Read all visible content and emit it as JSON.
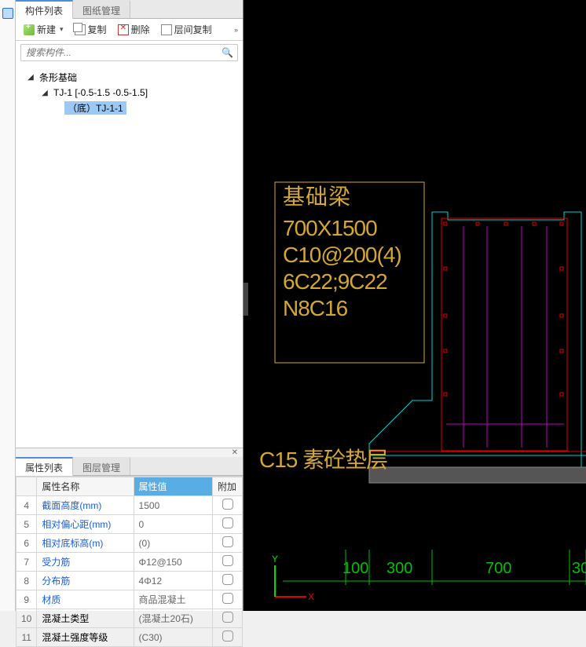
{
  "top_tabs": {
    "list": "构件列表",
    "drawing_mgr": "图纸管理"
  },
  "toolbar": {
    "new": "新建",
    "copy": "复制",
    "delete": "删除",
    "layer_copy": "层间复制"
  },
  "search": {
    "placeholder": "搜索构件..."
  },
  "tree": {
    "root": "条形基础",
    "node1": "TJ-1 [-0.5-1.5 -0.5-1.5]",
    "leaf1": "（底）TJ-1-1"
  },
  "lower_tabs": {
    "prop": "属性列表",
    "layer_mgr": "图层管理"
  },
  "prop_headers": {
    "name": "属性名称",
    "value": "属性值",
    "extra": "附加"
  },
  "props": [
    {
      "idx": 4,
      "name": "截面高度(mm)",
      "value": "1500",
      "link": true
    },
    {
      "idx": 5,
      "name": "相对偏心距(mm)",
      "value": "0",
      "link": true
    },
    {
      "idx": 6,
      "name": "相对底标高(m)",
      "value": "(0)",
      "link": true
    },
    {
      "idx": 7,
      "name": "受力筋",
      "value": "Φ12@150",
      "link": true
    },
    {
      "idx": 8,
      "name": "分布筋",
      "value": "4Φ12",
      "link": true
    },
    {
      "idx": 9,
      "name": "材质",
      "value": "商品混凝土",
      "link": true
    },
    {
      "idx": 10,
      "name": "混凝土类型",
      "value": "(混凝土20石)",
      "link": false
    },
    {
      "idx": 11,
      "name": "混凝土强度等级",
      "value": "(C30)",
      "link": false
    }
  ],
  "cad": {
    "labels": [
      "基础梁",
      "700X1500",
      "C10@200(4)",
      "6C22;9C22",
      "N8C16"
    ],
    "bedding": "C15 素砼垫层",
    "dims": [
      "100",
      "300",
      "700",
      "30"
    ]
  }
}
